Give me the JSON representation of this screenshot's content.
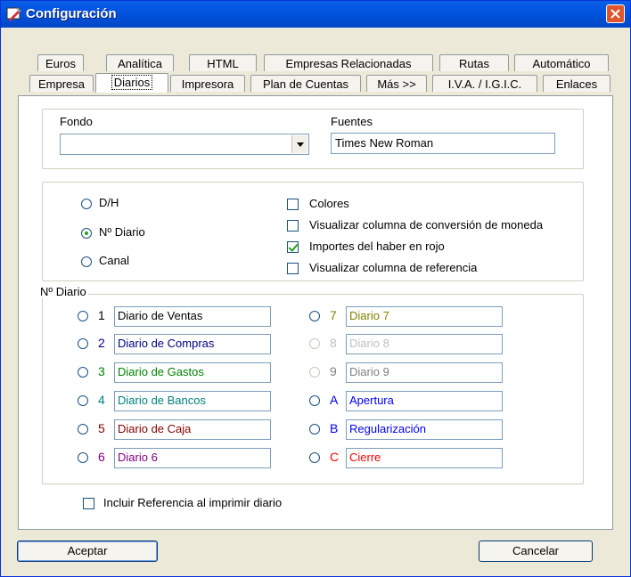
{
  "window": {
    "title": "Configuración"
  },
  "tabs": {
    "row1": [
      {
        "label": "Euros"
      },
      {
        "label": "Analítica"
      },
      {
        "label": "HTML"
      },
      {
        "label": "Empresas Relacionadas"
      },
      {
        "label": "Rutas"
      },
      {
        "label": "Automático"
      }
    ],
    "row2": [
      {
        "label": "Empresa"
      },
      {
        "label": "Diarios"
      },
      {
        "label": "Impresora"
      },
      {
        "label": "Plan de Cuentas"
      },
      {
        "label": "Más >>"
      },
      {
        "label": "I.V.A. / I.G.I.C."
      },
      {
        "label": "Enlaces"
      }
    ],
    "active": "Diarios"
  },
  "fondo": {
    "label": "Fondo",
    "value": ""
  },
  "fuentes": {
    "label": "Fuentes",
    "value": "Times New Roman"
  },
  "mode": {
    "options": [
      {
        "label": "D/H",
        "checked": false
      },
      {
        "label": "Nº Diario",
        "checked": true
      },
      {
        "label": "Canal",
        "checked": false
      }
    ]
  },
  "checks": [
    {
      "label": "Colores",
      "checked": false
    },
    {
      "label": "Visualizar columna de conversión de moneda",
      "checked": false
    },
    {
      "label": "Importes del haber en rojo",
      "checked": true
    },
    {
      "label": "Visualizar columna de referencia",
      "checked": false
    }
  ],
  "diarios": {
    "legend": "Nº Diario",
    "left": [
      {
        "num": "1",
        "name": "Diario de Ventas",
        "color": "#000000"
      },
      {
        "num": "2",
        "name": "Diario de Compras",
        "color": "#000080"
      },
      {
        "num": "3",
        "name": "Diario de Gastos",
        "color": "#008000"
      },
      {
        "num": "4",
        "name": "Diario de Bancos",
        "color": "#008080"
      },
      {
        "num": "5",
        "name": "Diario de Caja",
        "color": "#800000"
      },
      {
        "num": "6",
        "name": "Diario 6",
        "color": "#800080"
      }
    ],
    "right": [
      {
        "num": "7",
        "name": "Diario 7",
        "color": "#808000",
        "disabled": false
      },
      {
        "num": "8",
        "name": "Diario 8",
        "color": "#c0c0c0",
        "disabled": true
      },
      {
        "num": "9",
        "name": "Diario 9",
        "color": "#808080",
        "disabled": true
      },
      {
        "num": "A",
        "name": "Apertura",
        "color": "#0000ff",
        "disabled": false
      },
      {
        "num": "B",
        "name": "Regularización",
        "color": "#0000ff",
        "disabled": false
      },
      {
        "num": "C",
        "name": "Cierre",
        "color": "#ff0000",
        "disabled": false
      }
    ]
  },
  "incluir": {
    "label": "Incluir Referencia al imprimir diario",
    "checked": false
  },
  "buttons": {
    "accept": "Aceptar",
    "cancel": "Cancelar"
  }
}
